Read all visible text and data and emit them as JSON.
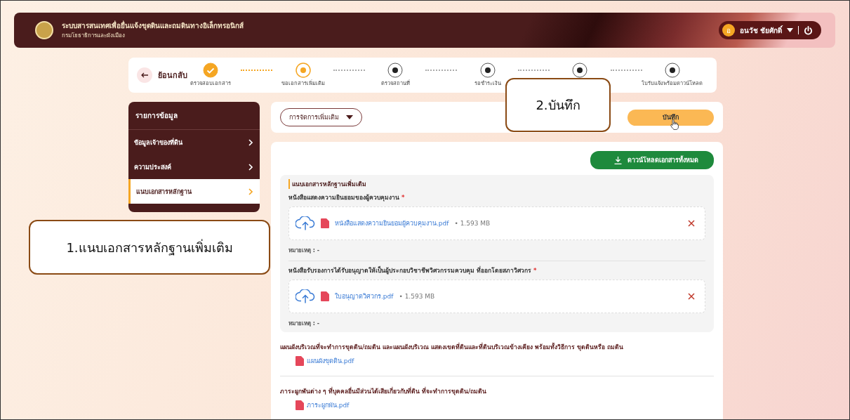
{
  "header": {
    "title": "ระบบสารสนเทศเพื่อยื่นแจ้งขุดดินและถมดินทางอิเล็กทรอนิกส์",
    "subtitle": "กรมโยธาธิการและผังเมือง",
    "user": {
      "initial": "อ",
      "name": "อนวัช ชัยศักดิ์"
    }
  },
  "stepper": {
    "back": "ย้อนกลับ",
    "steps": [
      {
        "label": "ตรวจสอบเอกสาร",
        "done": true,
        "current": false
      },
      {
        "label": "ขอเอกสารเพิ่มเติม",
        "done": false,
        "current": true
      },
      {
        "label": "ตรวจสถานที่",
        "done": false,
        "current": false
      },
      {
        "label": "รอชำระเงิน",
        "done": false,
        "current": false
      },
      {
        "done": false,
        "current": false
      },
      {
        "label": "ใบรับแจ้งพร้อมดาวน์โหลด",
        "done": false,
        "current": false
      }
    ]
  },
  "sidebar": {
    "title": "รายการข้อมูล",
    "items": [
      {
        "label": "ข้อมูลเจ้าของที่ดิน",
        "selected": false
      },
      {
        "label": "ความประสงค์",
        "selected": false
      },
      {
        "label": "แนบเอกสารหลักฐาน",
        "selected": true
      }
    ]
  },
  "actions": {
    "dropdown": "การจัดการเพิ่มเติม",
    "save": "บันทึก"
  },
  "download_all": "ดาวน์โหลดเอกสารทั้งหมด",
  "upload_section": {
    "title": "แนบเอกสารหลักฐานเพิ่มเติม",
    "fields": [
      {
        "label": "หนังสือแสดงความยินยอมของผู้ควบคุมงาน",
        "required_mark": "*",
        "file": "หนังสือแสดงความยินยอมผู้ควบคุมงาน.pdf",
        "size": "• 1.593 MB",
        "note": "หมายเหตุ : -"
      },
      {
        "label": "หนังสือรับรองการได้รับอนุญาตให้เป็นผู้ประกอบวิชาชีพวิศวกรรมควบคุม ที่ออกโดยสภาวิศวกร",
        "required_mark": "*",
        "file": "ใบอนุญาตวิศวกร.pdf",
        "size": "• 1.593 MB",
        "note": "หมายเหตุ : -"
      }
    ]
  },
  "documents": [
    {
      "label": "แผนผังบริเวณที่จะทำการขุดดิน/ถมดิน และแผนผังบริเวณ แสดงเขตที่ดินและที่ดินบริเวณข้างเคียง พร้อมทั้งวิธีการ ขุดดินหรือ ถมดิน",
      "file": "แผนผังขุดดิน.pdf"
    },
    {
      "label": "ภาระผูกพันต่าง ๆ ที่บุคคลอื่นมีส่วนได้เสียเกี่ยวกับที่ดิน ที่จะทำการขุดดิน/ถมดิน",
      "file": "ภาระผูกพัน.pdf"
    }
  ],
  "callouts": [
    {
      "text": "1.แนบเอกสารหลักฐานเพิ่มเติม"
    },
    {
      "text": "2.บันทึก"
    }
  ]
}
